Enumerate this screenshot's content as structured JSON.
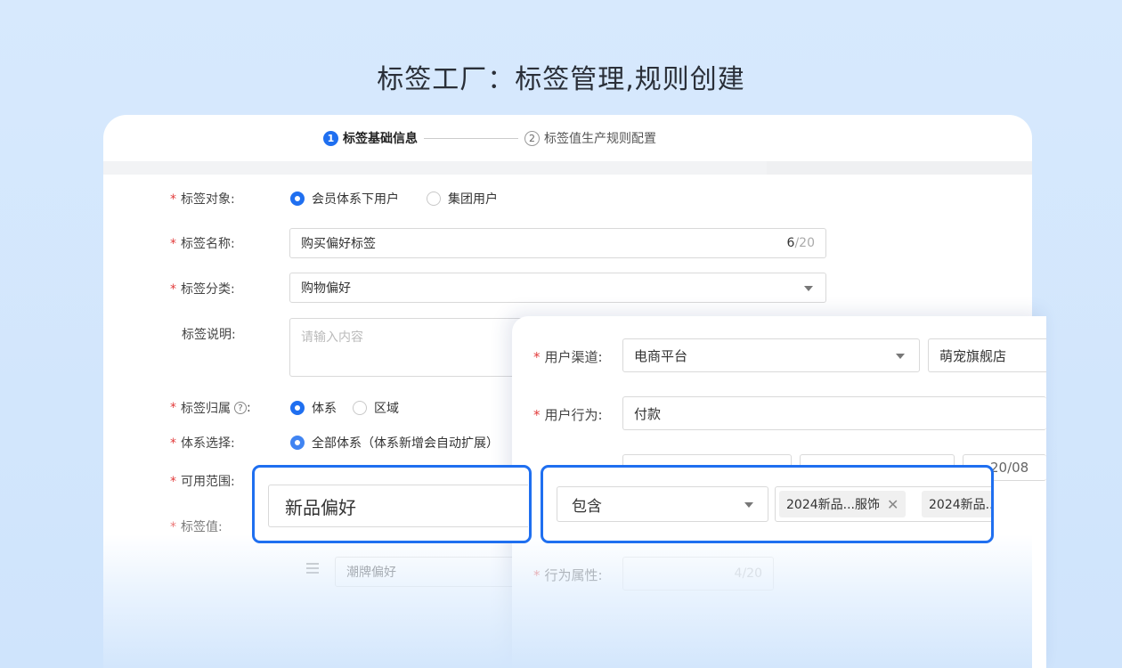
{
  "page_title": "标签工厂：标签管理,规则创建",
  "steps": [
    {
      "num": "1",
      "label": "标签基础信息"
    },
    {
      "num": "2",
      "label": "标签值生产规则配置"
    }
  ],
  "form": {
    "target": {
      "label": "标签对象:",
      "options": [
        "会员体系下用户",
        "集团用户"
      ],
      "selected": 0
    },
    "name": {
      "label": "标签名称:",
      "value": "购买偏好标签",
      "count": "6",
      "max": "/20"
    },
    "category": {
      "label": "标签分类:",
      "value": "购物偏好"
    },
    "description": {
      "label": "标签说明:",
      "placeholder": "请输入内容"
    },
    "belong": {
      "label": "标签归属",
      "help": "?",
      "colon": ":",
      "options": [
        "体系",
        "区域"
      ],
      "selected": 0
    },
    "system": {
      "label": "体系选择:",
      "option": "全部体系（体系新增会自动扩展）"
    },
    "scope": {
      "label": "可用范围:"
    },
    "tag_value": {
      "label": "标签值:",
      "row_value": "潮牌偏好"
    }
  },
  "panel": {
    "channel": {
      "label": "用户渠道:",
      "value": "电商平台",
      "value2": "萌宠旗舰店"
    },
    "behavior": {
      "label": "用户行为:",
      "value": "付款"
    },
    "date_fragment": "20/08",
    "attr": {
      "label": "行为属性:",
      "count": "4/20"
    }
  },
  "highlight_left": {
    "value": "新品偏好"
  },
  "highlight_right": {
    "operator": "包含",
    "tags": [
      "2024新品...服饰",
      "2024新品..."
    ]
  }
}
